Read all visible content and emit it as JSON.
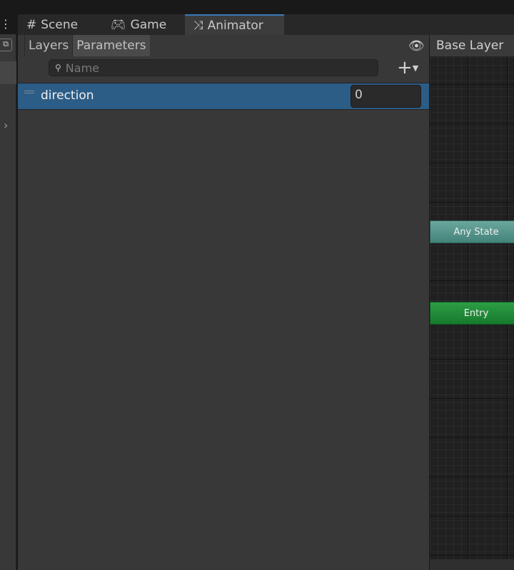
{
  "tabs": [
    {
      "label": "Scene",
      "icon": "grid-icon"
    },
    {
      "label": "Game",
      "icon": "gamepad-icon"
    },
    {
      "label": "Animator",
      "icon": "animator-icon",
      "active": true
    }
  ],
  "subtabs": [
    {
      "label": "Layers"
    },
    {
      "label": "Parameters",
      "active": true
    }
  ],
  "search": {
    "placeholder": "Name"
  },
  "parameters": [
    {
      "name": "direction",
      "value": "0"
    }
  ],
  "graph": {
    "layer": "Base Layer",
    "nodes": [
      {
        "label": "Any State",
        "color": "#5a998f"
      },
      {
        "label": "Entry",
        "color": "#218c3a"
      }
    ]
  }
}
